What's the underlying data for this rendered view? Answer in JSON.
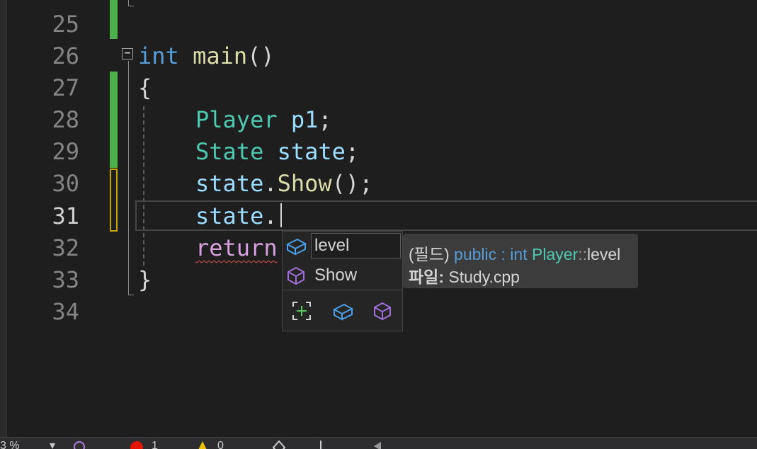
{
  "editor": {
    "line_numbers": [
      "25",
      "26",
      "27",
      "28",
      "29",
      "30",
      "31",
      "32",
      "33",
      "34"
    ],
    "current_line": "31",
    "code": {
      "l26_kw": "int",
      "l26_fn": "main",
      "l26_rest": "()",
      "l27": "{",
      "l28_type": "Player",
      "l28_var": "p1",
      "l28_end": ";",
      "l29_type": "State",
      "l29_var": "state",
      "l29_end": ";",
      "l30_var": "state",
      "l30_dot": ".",
      "l30_fn": "Show",
      "l30_end": "();",
      "l31_var": "state",
      "l31_dot": ".",
      "l32_kw": "return",
      "l33": "}"
    }
  },
  "autocomplete": {
    "items": [
      {
        "label": "level",
        "icon": "field-icon",
        "selected": true
      },
      {
        "label": "Show",
        "icon": "method-icon",
        "selected": false
      }
    ],
    "filters": [
      "expand-suggestions-icon",
      "field-filter-icon",
      "method-filter-icon"
    ]
  },
  "tooltip": {
    "kind": "(필드)",
    "modifier": "public :",
    "type": "int",
    "class": "Player",
    "scope": "::",
    "member": "level",
    "file_label": "파일:",
    "file_name": "Study.cpp"
  },
  "statusbar": {
    "zoom": "3 %",
    "errors": "1",
    "warnings": "0"
  },
  "colors": {
    "background": "#1e1e1e",
    "keyword": "#569cd6",
    "function": "#dcdcaa",
    "type": "#4ec9b0",
    "variable": "#9cdcfe",
    "control": "#d8a0df",
    "saved_change": "#4db04a",
    "unsaved_change": "#c8a400"
  }
}
